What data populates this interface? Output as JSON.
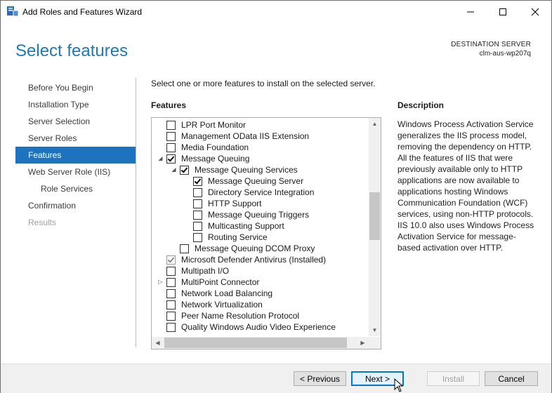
{
  "window": {
    "title": "Add Roles and Features Wizard"
  },
  "header": {
    "page_title": "Select features",
    "destination_label": "DESTINATION SERVER",
    "destination_server": "clm-aus-wp207q"
  },
  "nav": {
    "items": [
      {
        "label": "Before You Begin",
        "state": "normal"
      },
      {
        "label": "Installation Type",
        "state": "normal"
      },
      {
        "label": "Server Selection",
        "state": "normal"
      },
      {
        "label": "Server Roles",
        "state": "normal"
      },
      {
        "label": "Features",
        "state": "active"
      },
      {
        "label": "Web Server Role (IIS)",
        "state": "normal"
      },
      {
        "label": "Role Services",
        "state": "sub"
      },
      {
        "label": "Confirmation",
        "state": "normal"
      },
      {
        "label": "Results",
        "state": "disabled"
      }
    ]
  },
  "main": {
    "instruction": "Select one or more features to install on the selected server.",
    "features_header": "Features",
    "features": [
      {
        "label": "LPR Port Monitor",
        "level": 0,
        "checked": false,
        "expander": "none"
      },
      {
        "label": "Management OData IIS Extension",
        "level": 0,
        "checked": false,
        "expander": "none"
      },
      {
        "label": "Media Foundation",
        "level": 0,
        "checked": false,
        "expander": "none"
      },
      {
        "label": "Message Queuing",
        "level": 0,
        "checked": true,
        "expander": "expanded"
      },
      {
        "label": "Message Queuing Services",
        "level": 1,
        "checked": true,
        "expander": "expanded"
      },
      {
        "label": "Message Queuing Server",
        "level": 2,
        "checked": true,
        "expander": "none"
      },
      {
        "label": "Directory Service Integration",
        "level": 2,
        "checked": false,
        "expander": "none"
      },
      {
        "label": "HTTP Support",
        "level": 2,
        "checked": false,
        "expander": "none"
      },
      {
        "label": "Message Queuing Triggers",
        "level": 2,
        "checked": false,
        "expander": "none"
      },
      {
        "label": "Multicasting Support",
        "level": 2,
        "checked": false,
        "expander": "none"
      },
      {
        "label": "Routing Service",
        "level": 2,
        "checked": false,
        "expander": "none"
      },
      {
        "label": "Message Queuing DCOM Proxy",
        "level": 1,
        "checked": false,
        "expander": "none"
      },
      {
        "label": "Microsoft Defender Antivirus (Installed)",
        "level": 0,
        "checked": true,
        "expander": "none",
        "grayed": true
      },
      {
        "label": "Multipath I/O",
        "level": 0,
        "checked": false,
        "expander": "none"
      },
      {
        "label": "MultiPoint Connector",
        "level": 0,
        "checked": false,
        "expander": "collapsed"
      },
      {
        "label": "Network Load Balancing",
        "level": 0,
        "checked": false,
        "expander": "none"
      },
      {
        "label": "Network Virtualization",
        "level": 0,
        "checked": false,
        "expander": "none"
      },
      {
        "label": "Peer Name Resolution Protocol",
        "level": 0,
        "checked": false,
        "expander": "none"
      },
      {
        "label": "Quality Windows Audio Video Experience",
        "level": 0,
        "checked": false,
        "expander": "none"
      }
    ],
    "description_header": "Description",
    "description_text": "Windows Process Activation Service generalizes the IIS process model, removing the dependency on HTTP. All the features of IIS that were previously available only to HTTP applications are now available to applications hosting Windows Communication Foundation (WCF) services, using non-HTTP protocols. IIS 10.0 also uses Windows Process Activation Service for message-based activation over HTTP."
  },
  "footer": {
    "previous_label": "< Previous",
    "next_label": "Next >",
    "install_label": "Install",
    "cancel_label": "Cancel"
  },
  "colors": {
    "accent": "#1e73be",
    "title_blue": "#1e7bb7",
    "footer_bg": "#f0f0f0"
  },
  "icons": [
    "server-manager-icon",
    "minimize-icon",
    "maximize-icon",
    "close-icon",
    "expand-arrow-icon",
    "collapse-arrow-icon",
    "checkbox-icon",
    "scroll-up-icon",
    "scroll-down-icon",
    "scroll-left-icon",
    "scroll-right-icon",
    "mouse-cursor-icon"
  ]
}
